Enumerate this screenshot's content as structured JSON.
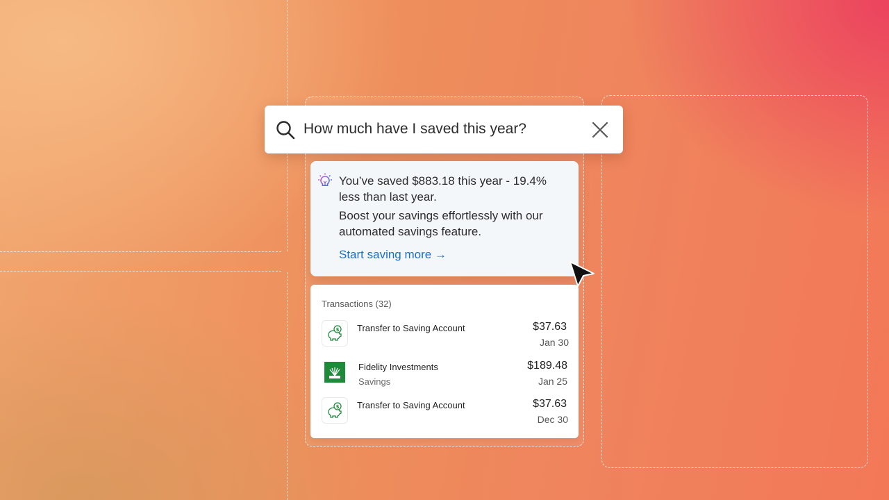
{
  "search": {
    "query": "How much have I saved this year?",
    "search_icon": "search-icon",
    "clear_icon": "close-icon"
  },
  "insight": {
    "icon": "lightbulb-icon",
    "line1": "You’ve saved $883.18 this year - 19.4% less than last year.",
    "line2": "Boost your savings effortlessly with our automated savings feature.",
    "cta": "Start saving more →",
    "accent": "#1a6fc9"
  },
  "transactions": {
    "header": "Transactions (32)",
    "items": [
      {
        "icon": "piggy-bank-icon",
        "name": "Transfer to Saving Account",
        "sub": "",
        "amount": "$37.63",
        "date": "Jan 30"
      },
      {
        "icon": "fidelity-logo-icon",
        "name": "Fidelity Investments",
        "sub": "Savings",
        "amount": "$189.48",
        "date": "Jan 25"
      },
      {
        "icon": "piggy-bank-icon",
        "name": "Transfer to Saving Account",
        "sub": "",
        "amount": "$37.63",
        "date": "Dec 30"
      }
    ]
  },
  "pointer": {
    "icon": "mouse-cursor-icon"
  }
}
